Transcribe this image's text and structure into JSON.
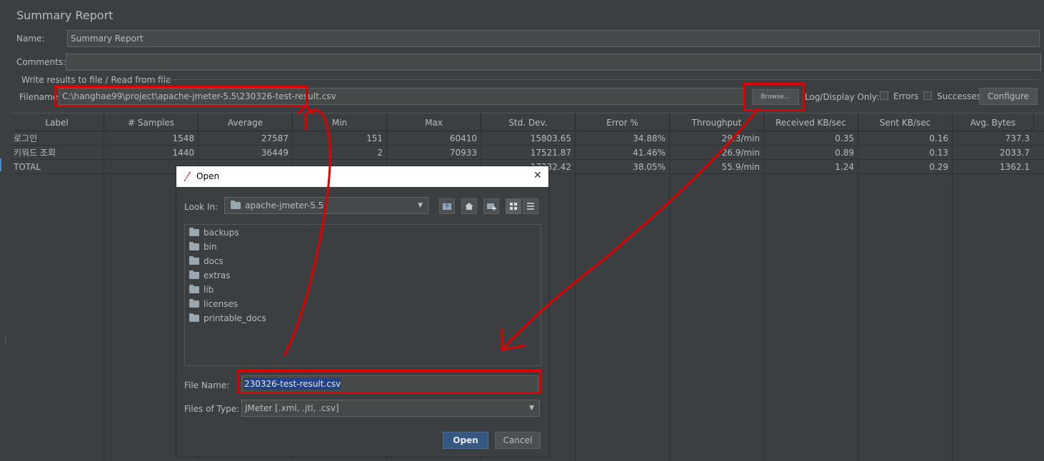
{
  "panel": {
    "title": "Summary Report",
    "name_label": "Name:",
    "name_value": "Summary Report",
    "comments_label": "Comments:",
    "comments_value": "",
    "section_label": "Write results to file / Read from file",
    "filename_label": "Filename",
    "filename_value": "C:\\hanghae99\\project\\apache-jmeter-5.5\\230326-test-result.csv",
    "browse_label": "Browse...",
    "log_display_label": "Log/Display Only:",
    "errors_label": "Errors",
    "successes_label": "Successes",
    "configure_label": "Configure"
  },
  "table": {
    "columns": [
      "Label",
      "# Samples",
      "Average",
      "Min",
      "Max",
      "Std. Dev.",
      "Error %",
      "Throughput",
      "Received KB/sec",
      "Sent KB/sec",
      "Avg. Bytes"
    ],
    "rows": [
      [
        "로그인",
        "1548",
        "27587",
        "151",
        "60410",
        "15803.65",
        "34.88%",
        "29.3/min",
        "0.35",
        "0.16",
        "737.3"
      ],
      [
        "키워드 조회",
        "1440",
        "36449",
        "2",
        "70933",
        "17521.87",
        "41.46%",
        "26.9/min",
        "0.89",
        "0.13",
        "2033.7"
      ],
      [
        "TOTAL",
        "",
        "",
        "",
        "",
        "17232.42",
        "38.05%",
        "55.9/min",
        "1.24",
        "0.29",
        "1362.1"
      ]
    ]
  },
  "dialog": {
    "title": "Open",
    "look_in_label": "Look In:",
    "look_in_value": "apache-jmeter-5.5",
    "folders": [
      "backups",
      "bin",
      "docs",
      "extras",
      "lib",
      "licenses",
      "printable_docs"
    ],
    "file_name_label": "File Name:",
    "file_name_value": "230326-test-result.csv",
    "files_of_type_label": "Files of Type:",
    "files_of_type_value": "JMeter [.xml, .jtl, .csv]",
    "open_label": "Open",
    "cancel_label": "Cancel",
    "close_glyph": "✕"
  },
  "colors": {
    "background": "#3c3f41",
    "annotation": "#e00000",
    "primary_button": "#365880",
    "selection": "#214283"
  }
}
